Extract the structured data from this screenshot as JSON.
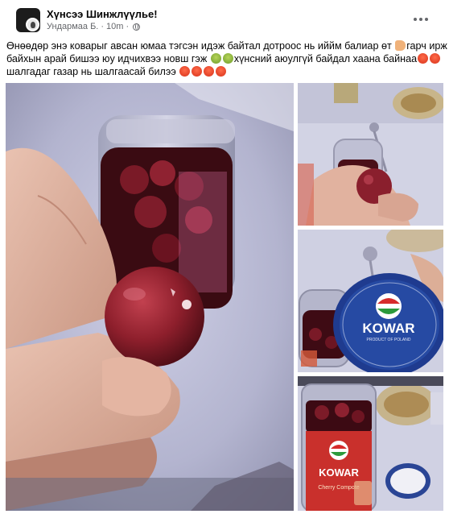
{
  "post": {
    "group_name": "Хүнсээ Шинжлүүлье!",
    "author": "Ундармаа Б.",
    "separator": "·",
    "time": "10m",
    "privacy_icon": "globe-icon",
    "more_icon": "more-options-icon",
    "text_lines": [
      "Өнөөдөр энэ коварыг авсан юмаа тэгсэн идэж байтал дотроос нь иййм балиар өт",
      "гарч ирж",
      "байхын арай бишээ юу идчихвээ новш гэж",
      "хүнсний аюулгүй байдал хаана байнаа",
      "шалгадаг газар нь шалгаасай билээ"
    ]
  },
  "photos": {
    "main": "photo-cherry-closeup",
    "thumb_1": "photo-cherry-hand",
    "thumb_2": "photo-kowar-lid",
    "thumb_3": "photo-kowar-jar"
  },
  "brand": {
    "lid_name": "KOWAR",
    "lid_sub": "PRODUCT OF POLAND",
    "jar_name": "KOWAR",
    "jar_label": "Cherry Compote"
  },
  "colors": {
    "name": "#050505",
    "meta": "#65676b",
    "lid_blue": "#1f3b8f",
    "cherry": "#8e1f2c"
  }
}
